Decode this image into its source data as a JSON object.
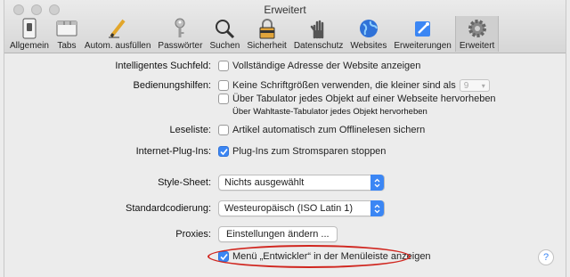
{
  "window": {
    "title": "Erweitert"
  },
  "toolbar": {
    "tabs": [
      {
        "label": "Allgemein",
        "icon": "switch-icon"
      },
      {
        "label": "Tabs",
        "icon": "tabs-icon"
      },
      {
        "label": "Autom. ausfüllen",
        "icon": "pencil-icon"
      },
      {
        "label": "Passwörter",
        "icon": "key-icon"
      },
      {
        "label": "Suchen",
        "icon": "magnifier-icon"
      },
      {
        "label": "Sicherheit",
        "icon": "lock-icon"
      },
      {
        "label": "Datenschutz",
        "icon": "hand-icon"
      },
      {
        "label": "Websites",
        "icon": "globe-icon"
      },
      {
        "label": "Erweiterungen",
        "icon": "puzzle-icon"
      },
      {
        "label": "Erweitert",
        "icon": "gear-icon"
      }
    ],
    "active": "Erweitert"
  },
  "settings": {
    "smart_search": {
      "label": "Intelligentes Suchfeld:",
      "option": "Vollständige Adresse der Website anzeigen",
      "checked": false
    },
    "accessibility": {
      "label": "Bedienungshilfen:",
      "option1": "Keine Schriftgrößen verwenden, die kleiner sind als",
      "option1_value": "9",
      "option2": "Über Tabulator jedes Objekt auf einer Webseite hervorheben",
      "hint": "Über Wahltaste-Tabulator jedes Objekt hervorheben"
    },
    "reading_list": {
      "label": "Leseliste:",
      "option": "Artikel automatisch zum Offlinelesen sichern",
      "checked": false
    },
    "plugins": {
      "label": "Internet-Plug-Ins:",
      "option": "Plug-Ins zum Stromsparen stoppen",
      "checked": true
    },
    "style_sheet": {
      "label": "Style-Sheet:",
      "value": "Nichts ausgewählt"
    },
    "encoding": {
      "label": "Standardcodierung:",
      "value": "Westeuropäisch (ISO Latin 1)"
    },
    "proxies": {
      "label": "Proxies:",
      "button": "Einstellungen ändern ..."
    },
    "developer_menu": {
      "option": "Menü „Entwickler“ in der Menüleiste anzeigen",
      "checked": true
    }
  },
  "help": {
    "symbol": "?"
  },
  "colors": {
    "accent": "#3b86f4",
    "highlight_ellipse": "#d0261f"
  }
}
